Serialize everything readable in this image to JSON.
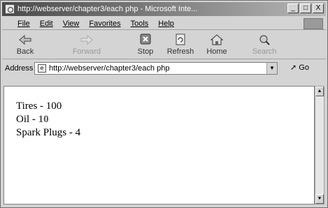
{
  "window": {
    "title": "http://webserver/chapter3/each php - Microsoft Inte...",
    "buttons": [
      "_",
      "□",
      "X"
    ]
  },
  "menu": {
    "items": [
      "File",
      "Edit",
      "View",
      "Favorites",
      "Tools",
      "Help"
    ]
  },
  "toolbar": {
    "back_label": "Back",
    "forward_label": "Forward",
    "stop_label": "Stop",
    "refresh_label": "Refresh",
    "home_label": "Home",
    "search_label": "Search"
  },
  "address": {
    "label": "Address",
    "url": "http://webserver/chapter3/each php",
    "go_label": "Go"
  },
  "page": {
    "lines": [
      {
        "name": "Tires",
        "value": "100"
      },
      {
        "name": "Oil",
        "value": "10"
      },
      {
        "name": "Spark Plugs",
        "value": "4"
      }
    ]
  },
  "icons": {
    "back": "back-arrow-icon",
    "forward": "forward-arrow-icon",
    "stop": "stop-icon",
    "refresh": "refresh-icon",
    "home": "home-icon",
    "search": "search-icon"
  }
}
